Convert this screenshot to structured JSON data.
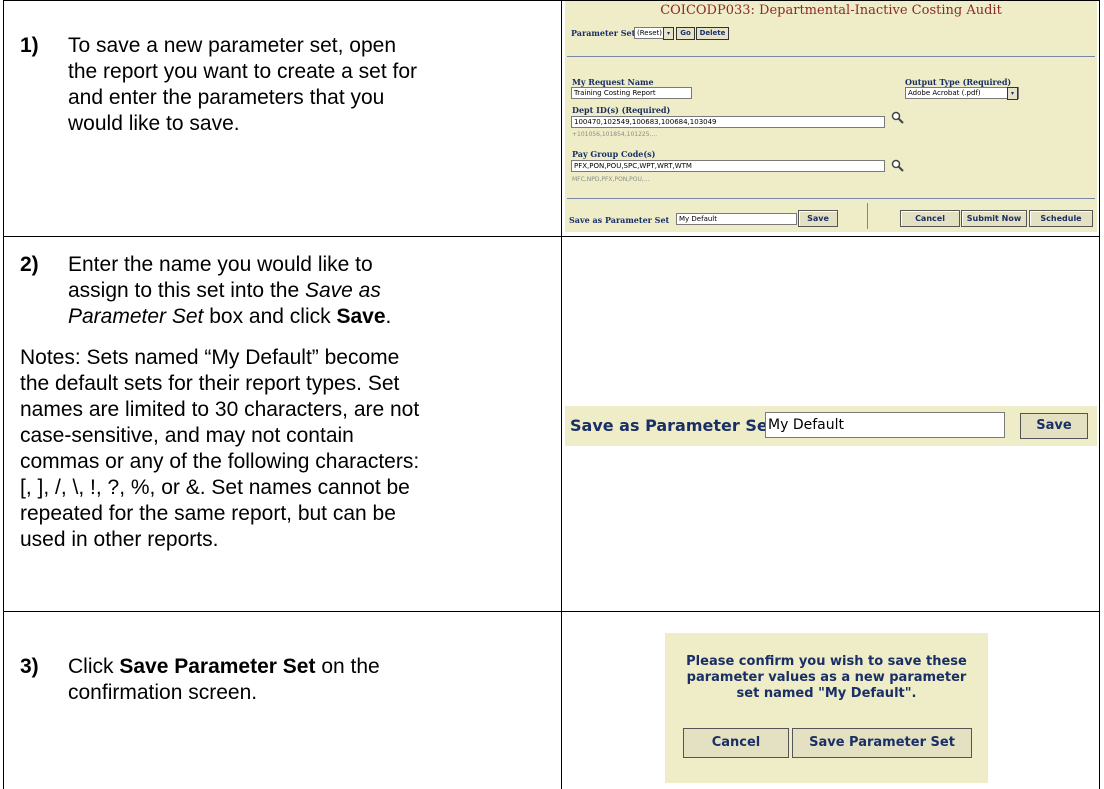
{
  "steps": [
    {
      "number": "1)",
      "lines": [
        "To save a new parameter set, open",
        "the report you want to create a set for",
        "and enter the parameters that you",
        "would like to save."
      ]
    },
    {
      "number": "2)",
      "line1": "Enter the name you would like to",
      "line2": "assign to this set into the",
      "line2_italic": "Save as",
      "line3_italic": "Parameter Set",
      "line3_rest": " box and click ",
      "line3_bold": "Save",
      "line3_end": ".",
      "notes_lines": [
        "Notes: Sets named “My Default” become",
        "the default sets for their report types. Set",
        "names are limited to 30 characters, are not",
        "case-sensitive, and may not contain",
        "commas or any of the following characters:",
        "[, ], /, \\, !, ?, %, or &. Set names cannot be",
        "repeated for the same report, but can be",
        "used in other reports."
      ]
    },
    {
      "number": "3)",
      "pre": "Click ",
      "bold": "Save Parameter Set",
      "post": " on the",
      "line2": "confirmation screen."
    }
  ],
  "screenshot1": {
    "title": "COICODP033: Departmental-Inactive Costing Audit",
    "parameter_set_label": "Parameter Set",
    "parameter_set_value": "(Reset)",
    "go_label": "Go",
    "delete_label": "Delete",
    "request_name_label": "My Request Name",
    "request_name_value": "Training Costing Report",
    "output_type_label": "Output Type (Required)",
    "output_type_value": "Adobe Acrobat (.pdf)",
    "dept_label": "Dept ID(s) (Required)",
    "dept_value": "100470,102549,100683,100684,103049",
    "dept_hint": "+101056,101854,101225,...",
    "paygroup_label": "Pay Group Code(s)",
    "paygroup_value": "PFX,PON,POU,SPC,WPT,WRT,WTM",
    "paygroup_hint": "MFC,NPD,PFX,PON,POU,...",
    "save_as_label": "Save as Parameter Set",
    "save_as_value": "My Default",
    "save_label": "Save",
    "cancel_label": "Cancel",
    "submit_label": "Submit Now",
    "schedule_label": "Schedule"
  },
  "screenshot2": {
    "save_as_label": "Save as Parameter Set",
    "save_as_value": "My Default",
    "save_label": "Save"
  },
  "screenshot3": {
    "message_lines": [
      "Please confirm you wish to save these",
      "parameter values as a new parameter",
      "set named \"My Default\"."
    ],
    "cancel_label": "Cancel",
    "save_set_label": "Save Parameter Set"
  }
}
